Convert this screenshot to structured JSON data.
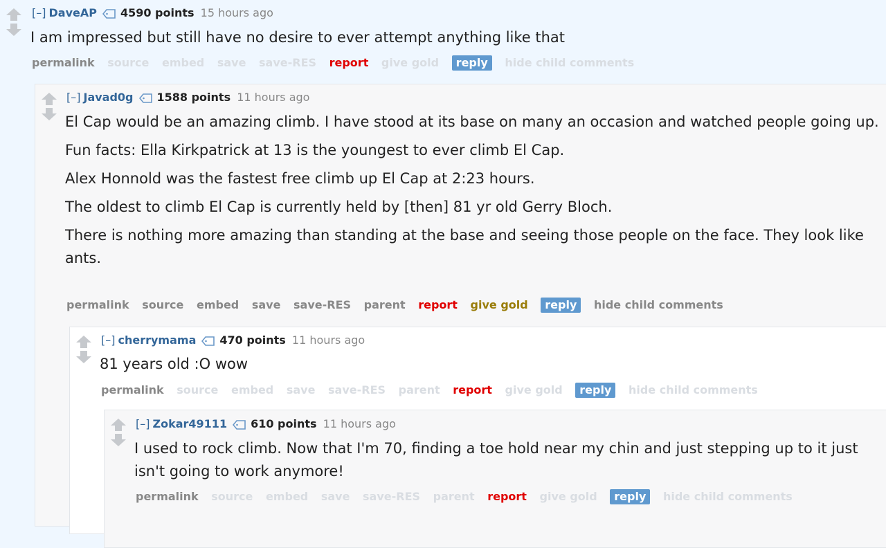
{
  "comments": [
    {
      "author": "DaveAP",
      "points": "4590 points",
      "time": "15 hours ago",
      "collapse": "[–]",
      "body": [
        "I am impressed but still have no desire to ever attempt anything like that"
      ],
      "buttons": {
        "permalink": "permalink",
        "source": "source",
        "embed": "embed",
        "save": "save",
        "save_res": "save-RES",
        "report": "report",
        "give_gold": "give gold",
        "reply": "reply",
        "hide": "hide child comments"
      }
    },
    {
      "author": "Javad0g",
      "points": "1588 points",
      "time": "11 hours ago",
      "collapse": "[–]",
      "body": [
        "El Cap would be an amazing climb. I have stood at its base on many an occasion and watched people going up.",
        "Fun facts: Ella Kirkpatrick at 13 is the youngest to ever climb El Cap.",
        "Alex Honnold was the fastest free climb up El Cap at 2:23 hours.",
        "The oldest to climb El Cap is currently held by [then] 81 yr old Gerry Bloch.",
        "There is nothing more amazing than standing at the base and seeing those people on the face. They look like ants."
      ],
      "buttons": {
        "permalink": "permalink",
        "source": "source",
        "embed": "embed",
        "save": "save",
        "save_res": "save-RES",
        "parent": "parent",
        "report": "report",
        "give_gold": "give gold",
        "reply": "reply",
        "hide": "hide child comments"
      }
    },
    {
      "author": "cherrymama",
      "points": "470 points",
      "time": "11 hours ago",
      "collapse": "[–]",
      "body": [
        "81 years old :O wow"
      ],
      "buttons": {
        "permalink": "permalink",
        "source": "source",
        "embed": "embed",
        "save": "save",
        "save_res": "save-RES",
        "parent": "parent",
        "report": "report",
        "give_gold": "give gold",
        "reply": "reply",
        "hide": "hide child comments"
      }
    },
    {
      "author": "Zokar49111",
      "points": "610 points",
      "time": "11 hours ago",
      "collapse": "[–]",
      "body": [
        "I used to rock climb. Now that I'm 70, finding a toe hold near my chin and just stepping up to it just isn't going to work anymore!"
      ],
      "buttons": {
        "permalink": "permalink",
        "source": "source",
        "embed": "embed",
        "save": "save",
        "save_res": "save-RES",
        "parent": "parent",
        "report": "report",
        "give_gold": "give gold",
        "reply": "reply",
        "hide": "hide child comments"
      }
    }
  ],
  "icons": {
    "upvote": "upvote-arrow-icon",
    "downvote": "downvote-arrow-icon",
    "tag": "user-tag-icon"
  },
  "colors": {
    "author": "#336699",
    "report": "#e00000",
    "reply_bg": "#5f99cf",
    "gold": "#9a7d0a"
  }
}
